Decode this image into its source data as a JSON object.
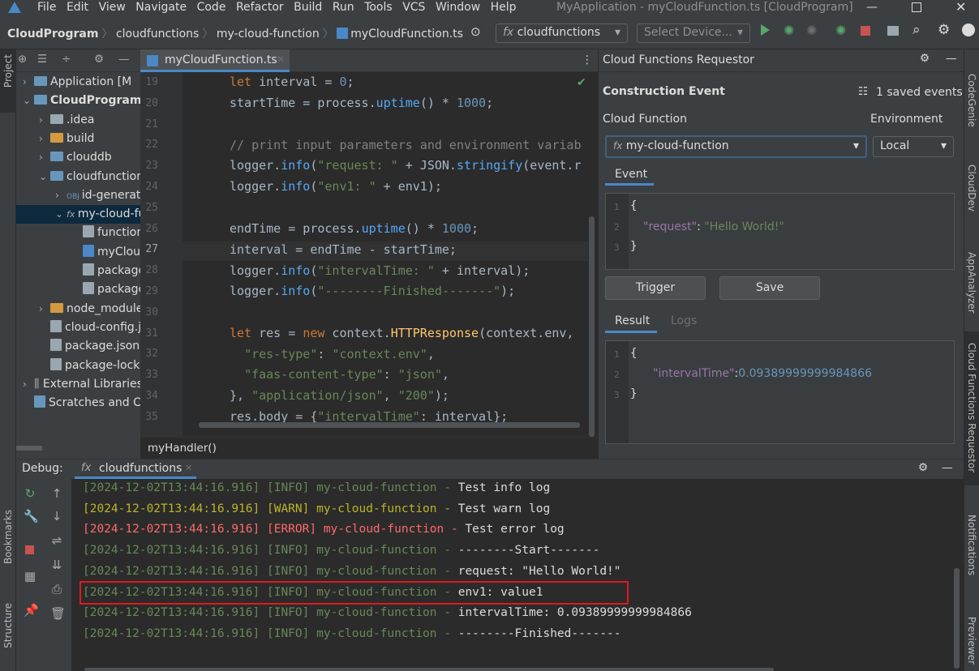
{
  "titlebar": {
    "menu": [
      "File",
      "Edit",
      "View",
      "Navigate",
      "Code",
      "Refactor",
      "Build",
      "Run",
      "Tools",
      "VCS",
      "Window",
      "Help"
    ],
    "title": "MyApplication - myCloudFunction.ts [CloudProgram]"
  },
  "navbar": {
    "crumbs": [
      "CloudProgram",
      "cloudfunctions",
      "my-cloud-function",
      "myCloudFunction.ts"
    ],
    "run_config": "cloudfunctions",
    "device": "Select Device..."
  },
  "sidebar_left": {
    "project": "Project",
    "bookmarks": "Bookmarks",
    "structure": "Structure"
  },
  "project_tree": [
    {
      "label": "Application [M",
      "kind": "folder-blue",
      "indent": 0,
      "arrow": ">"
    },
    {
      "label": "CloudProgram",
      "kind": "folder-blue",
      "indent": 0,
      "arrow": "v",
      "bold": true
    },
    {
      "label": ".idea",
      "kind": "folder",
      "indent": 1,
      "arrow": ">"
    },
    {
      "label": "build",
      "kind": "folder-orange",
      "indent": 1,
      "arrow": ">"
    },
    {
      "label": "clouddb",
      "kind": "folder-blue",
      "indent": 1,
      "arrow": ">"
    },
    {
      "label": "cloudfunctions",
      "kind": "folder-blue",
      "indent": 1,
      "arrow": "v"
    },
    {
      "label": "id-generator",
      "kind": "obj",
      "indent": 2,
      "arrow": ">"
    },
    {
      "label": "my-cloud-function",
      "kind": "fx",
      "indent": 2,
      "arrow": "v",
      "selected": true
    },
    {
      "label": "function-config.json",
      "kind": "file",
      "indent": 3,
      "arrow": ""
    },
    {
      "label": "myCloudFunction.ts",
      "kind": "ts",
      "indent": 3,
      "arrow": ""
    },
    {
      "label": "package.json",
      "kind": "file",
      "indent": 3,
      "arrow": ""
    },
    {
      "label": "package-lock.json",
      "kind": "file",
      "indent": 3,
      "arrow": ""
    },
    {
      "label": "node_modules",
      "kind": "folder-orange",
      "indent": 1,
      "arrow": ">"
    },
    {
      "label": "cloud-config.json",
      "kind": "file",
      "indent": 1,
      "arrow": ""
    },
    {
      "label": "package.json",
      "kind": "file",
      "indent": 1,
      "arrow": ""
    },
    {
      "label": "package-lock.json",
      "kind": "file",
      "indent": 1,
      "arrow": ""
    },
    {
      "label": "External Libraries",
      "kind": "lib",
      "indent": 0,
      "arrow": ">"
    },
    {
      "label": "Scratches and Consoles",
      "kind": "scratch",
      "indent": 0,
      "arrow": ""
    }
  ],
  "editor": {
    "tab": "myCloudFunction.ts",
    "breadcrumb": "myHandler()",
    "line_numbers": [
      "19",
      "20",
      "21",
      "22",
      "23",
      "24",
      "25",
      "26",
      "27",
      "28",
      "29",
      "30",
      "31",
      "32",
      "33",
      "34",
      "35"
    ]
  },
  "requestor": {
    "panel_title": "Cloud Functions Requestor",
    "section_title": "Construction Event",
    "saved_events": "1 saved events",
    "cloud_function_label": "Cloud Function",
    "environment_label": "Environment",
    "cloud_function_value": "my-cloud-function",
    "environment_value": "Local",
    "event_tab": "Event",
    "event_json_key": "\"request\"",
    "event_json_value": "\"Hello World!\"",
    "trigger_label": "Trigger",
    "save_label": "Save",
    "result_tab": "Result",
    "logs_tab": "Logs",
    "result_json_key": "\"intervalTime\"",
    "result_json_value": "0.09389999999984866"
  },
  "sidebar_right": {
    "codegenie": "CodeGenie",
    "clouddev": "CloudDev",
    "appanalyzer": "AppAnalyzer",
    "requestor": "Cloud Functions Requestor",
    "notifications": "Notifications",
    "previewer": "Previewer"
  },
  "debug": {
    "label": "Debug:",
    "tab": "cloudfunctions",
    "logs": [
      {
        "ts": "[2024-12-02T13:44:16.916]",
        "level": "[INFO]",
        "src": "my-cloud-function -",
        "msg": "Test info log",
        "type": "info"
      },
      {
        "ts": "[2024-12-02T13:44:16.916]",
        "level": "[WARN]",
        "src": "my-cloud-function -",
        "msg": "Test warn log",
        "type": "warn"
      },
      {
        "ts": "[2024-12-02T13:44:16.916]",
        "level": "[ERROR]",
        "src": "my-cloud-function -",
        "msg": "Test error log",
        "type": "error"
      },
      {
        "ts": "[2024-12-02T13:44:16.916]",
        "level": "[INFO]",
        "src": "my-cloud-function -",
        "msg": "--------Start-------",
        "type": "info"
      },
      {
        "ts": "[2024-12-02T13:44:16.916]",
        "level": "[INFO]",
        "src": "my-cloud-function -",
        "msg": "request: \"Hello World!\"",
        "type": "info"
      },
      {
        "ts": "[2024-12-02T13:44:16.916]",
        "level": "[INFO]",
        "src": "my-cloud-function -",
        "msg": "env1: value1",
        "type": "info",
        "highlight": true
      },
      {
        "ts": "[2024-12-02T13:44:16.916]",
        "level": "[INFO]",
        "src": "my-cloud-function -",
        "msg": "intervalTime: 0.09389999999984866",
        "type": "info"
      },
      {
        "ts": "[2024-12-02T13:44:16.916]",
        "level": "[INFO]",
        "src": "my-cloud-function -",
        "msg": "--------Finished-------",
        "type": "info"
      }
    ]
  },
  "colors": {
    "highlight_box": "#e0191e",
    "accent": "#4a88c7",
    "bg": "#2b2b2b",
    "panel": "#3c3f41"
  }
}
